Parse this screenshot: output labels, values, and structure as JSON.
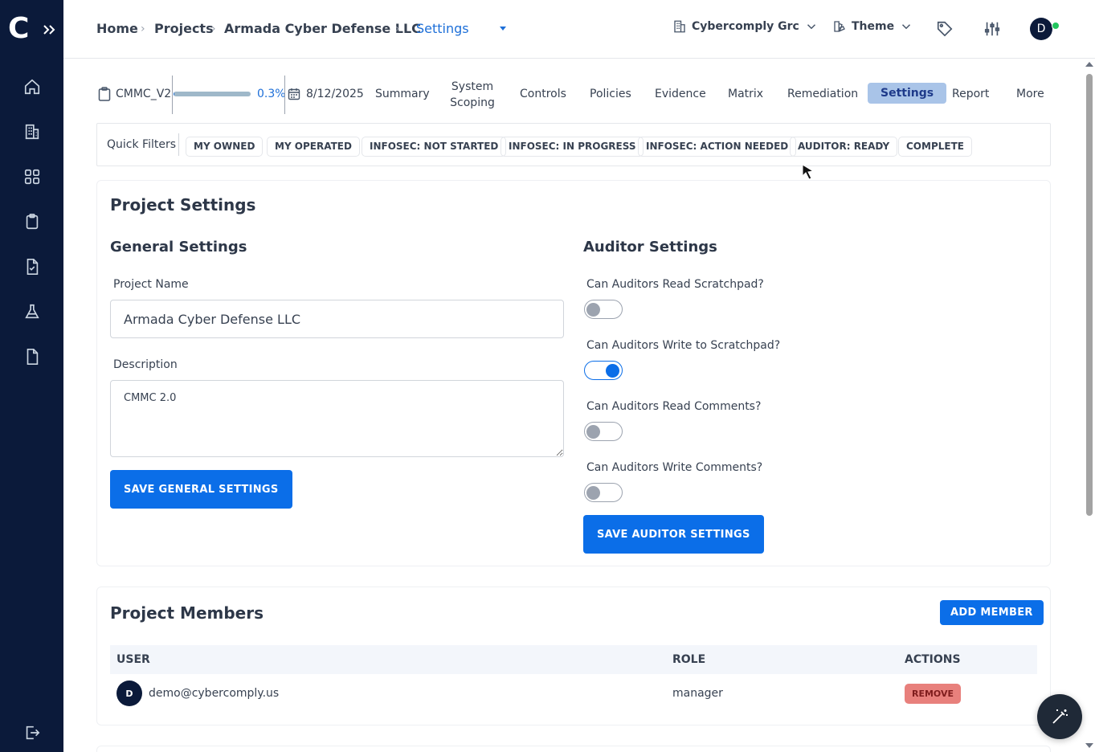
{
  "sidebar": {
    "logo": "C",
    "items": [
      {
        "icon": "home-icon"
      },
      {
        "icon": "building-icon"
      },
      {
        "icon": "grid-icon"
      },
      {
        "icon": "clipboard-icon"
      },
      {
        "icon": "file-check-icon"
      },
      {
        "icon": "flask-icon"
      },
      {
        "icon": "file-icon"
      }
    ],
    "logout_icon": "logout-icon"
  },
  "topbar": {
    "breadcrumb": [
      "Home",
      "Projects",
      "Armada Cyber Defense LLC"
    ],
    "active_crumb": "Settings",
    "org": "Cybercomply Grc",
    "theme": "Theme",
    "avatar": "D"
  },
  "project": {
    "code": "CMMC_V2",
    "progress": "0.3%",
    "progress_value": 0.003,
    "date": "8/12/2025",
    "tabs": [
      {
        "label": "Summary"
      },
      {
        "label": "System Scoping"
      },
      {
        "label": "Controls"
      },
      {
        "label": "Policies"
      },
      {
        "label": "Evidence"
      },
      {
        "label": "Matrix"
      },
      {
        "label": "Remediation"
      },
      {
        "label": "Settings",
        "active": true
      },
      {
        "label": "Report"
      },
      {
        "label": "More"
      }
    ]
  },
  "quick_filters": {
    "label": "Quick Filters",
    "chips": [
      "MY OWNED",
      "MY OPERATED",
      "INFOSEC: NOT STARTED",
      "INFOSEC: IN PROGRESS",
      "INFOSEC: ACTION NEEDED",
      "AUDITOR: READY",
      "COMPLETE"
    ]
  },
  "settings": {
    "title": "Project Settings",
    "general": {
      "title": "General Settings",
      "name_label": "Project Name",
      "name_value": "Armada Cyber Defense LLC",
      "desc_label": "Description",
      "desc_value": "CMMC 2.0",
      "save_label": "SAVE GENERAL SETTINGS"
    },
    "auditor": {
      "title": "Auditor Settings",
      "toggles": [
        {
          "label": "Can Auditors Read Scratchpad?",
          "on": false
        },
        {
          "label": "Can Auditors Write to Scratchpad?",
          "on": true
        },
        {
          "label": "Can Auditors Read Comments?",
          "on": false
        },
        {
          "label": "Can Auditors Write Comments?",
          "on": false
        }
      ],
      "save_label": "SAVE AUDITOR SETTINGS"
    }
  },
  "members": {
    "title": "Project Members",
    "add_label": "ADD MEMBER",
    "columns": [
      "USER",
      "ROLE",
      "ACTIONS"
    ],
    "rows": [
      {
        "avatar": "D",
        "email": "demo@cybercomply.us",
        "role": "manager",
        "action": "REMOVE"
      }
    ]
  },
  "colors": {
    "sidebar": "#0b1a3a",
    "primary": "#0b6ee8",
    "link": "#1d6fd8",
    "danger_badge": "#e8807c"
  }
}
